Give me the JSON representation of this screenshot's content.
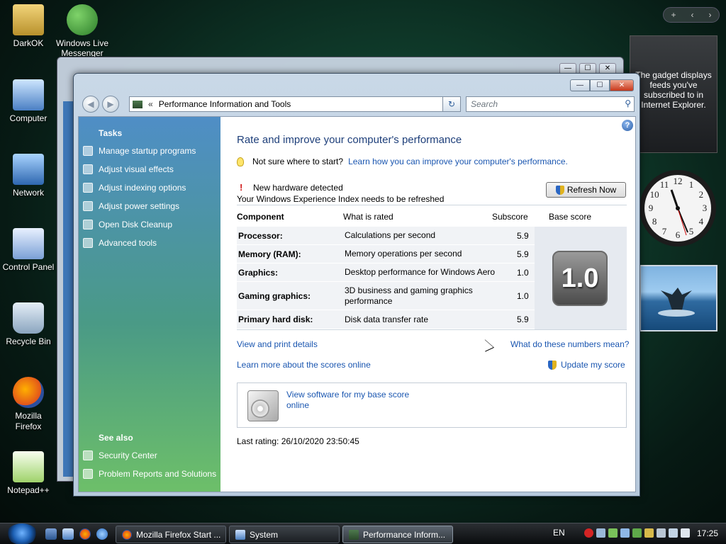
{
  "desktop": {
    "icons": [
      {
        "label": "DarkOK",
        "icon": "folder-icon"
      },
      {
        "label": "Windows Live Messenger",
        "icon": "messenger-icon"
      },
      {
        "label": "Computer",
        "icon": "computer-icon"
      },
      {
        "label": "Network",
        "icon": "network-icon"
      },
      {
        "label": "Control Panel",
        "icon": "control-panel-icon"
      },
      {
        "label": "Recycle Bin",
        "icon": "recycle-bin-icon"
      },
      {
        "label": "Mozilla Firefox",
        "icon": "firefox-icon"
      },
      {
        "label": "Notepad++",
        "icon": "notepad-plus-plus-icon"
      }
    ]
  },
  "gadgets": {
    "controls": {
      "add": "+",
      "prev": "‹",
      "next": "›"
    },
    "feed_text": "The gadget displays feeds you've subscribed to in Internet Explorer.",
    "clock_numbers": [
      "12",
      "1",
      "2",
      "3",
      "4",
      "5",
      "6",
      "7",
      "8",
      "9",
      "10",
      "11"
    ]
  },
  "window": {
    "controls": {
      "minimize": "—",
      "maximize": "☐",
      "close": "✕"
    },
    "nav": {
      "back": "◀",
      "forward": "▶"
    },
    "address": {
      "chevron": "«",
      "path": "Performance Information and Tools",
      "dropdown": "▼",
      "refresh": "↻"
    },
    "search": {
      "placeholder": "Search",
      "icon": "⚲"
    }
  },
  "sidebar": {
    "tasks_title": "Tasks",
    "items": [
      {
        "label": "Manage startup programs",
        "icon": "startup-programs-icon"
      },
      {
        "label": "Adjust visual effects",
        "icon": "shield-icon"
      },
      {
        "label": "Adjust indexing options",
        "icon": "indexing-icon"
      },
      {
        "label": "Adjust power settings",
        "icon": "power-icon"
      },
      {
        "label": "Open Disk Cleanup",
        "icon": "disk-cleanup-icon"
      },
      {
        "label": "Advanced tools",
        "icon": "advanced-tools-icon"
      }
    ],
    "see_also_title": "See also",
    "see_also": [
      {
        "label": "Security Center",
        "icon": "security-center-icon"
      },
      {
        "label": "Problem Reports and Solutions",
        "icon": "problem-reports-icon"
      }
    ]
  },
  "main": {
    "help": "?",
    "heading": "Rate and improve your computer's performance",
    "tip_text": "Not sure where to start?",
    "tip_link": "Learn how you can improve your computer's performance.",
    "warning_symbol": "!",
    "hardware_line1": "New hardware detected",
    "hardware_line2": "Your Windows Experience Index needs to be refreshed",
    "refresh_button": "Refresh Now",
    "table": {
      "headers": {
        "component": "Component",
        "rated": "What is rated",
        "subscore": "Subscore",
        "base": "Base score"
      },
      "rows": [
        {
          "component": "Processor:",
          "rated": "Calculations per second",
          "subscore": "5.9"
        },
        {
          "component": "Memory (RAM):",
          "rated": "Memory operations per second",
          "subscore": "5.9"
        },
        {
          "component": "Graphics:",
          "rated": "Desktop performance for Windows Aero",
          "subscore": "1.0"
        },
        {
          "component": "Gaming graphics:",
          "rated": "3D business and gaming graphics performance",
          "subscore": "1.0"
        },
        {
          "component": "Primary hard disk:",
          "rated": "Disk data transfer rate",
          "subscore": "5.9"
        }
      ],
      "base_score": "1.0"
    },
    "view_print": "View and print details",
    "what_numbers": "What do these numbers mean?",
    "learn_more": "Learn more about the scores online",
    "update_score": "Update my score",
    "software_link": "View software for my base score online",
    "last_rating": "Last rating: 26/10/2020 23:50:45"
  },
  "taskbar": {
    "tasks": [
      {
        "label": "Mozilla Firefox Start ...",
        "icon": "firefox-icon"
      },
      {
        "label": "System",
        "icon": "system-icon"
      },
      {
        "label": "Performance Inform...",
        "icon": "performance-icon"
      }
    ],
    "language": "EN",
    "time": "17:25"
  }
}
